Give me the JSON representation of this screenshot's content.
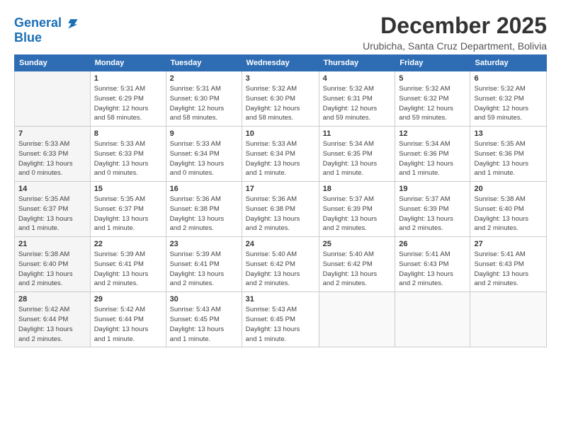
{
  "header": {
    "logo_line1": "General",
    "logo_line2": "Blue",
    "month_title": "December 2025",
    "subtitle": "Urubicha, Santa Cruz Department, Bolivia"
  },
  "calendar": {
    "days_of_week": [
      "Sunday",
      "Monday",
      "Tuesday",
      "Wednesday",
      "Thursday",
      "Friday",
      "Saturday"
    ],
    "weeks": [
      [
        {
          "day": "",
          "info": ""
        },
        {
          "day": "1",
          "info": "Sunrise: 5:31 AM\nSunset: 6:29 PM\nDaylight: 12 hours\nand 58 minutes."
        },
        {
          "day": "2",
          "info": "Sunrise: 5:31 AM\nSunset: 6:30 PM\nDaylight: 12 hours\nand 58 minutes."
        },
        {
          "day": "3",
          "info": "Sunrise: 5:32 AM\nSunset: 6:30 PM\nDaylight: 12 hours\nand 58 minutes."
        },
        {
          "day": "4",
          "info": "Sunrise: 5:32 AM\nSunset: 6:31 PM\nDaylight: 12 hours\nand 59 minutes."
        },
        {
          "day": "5",
          "info": "Sunrise: 5:32 AM\nSunset: 6:32 PM\nDaylight: 12 hours\nand 59 minutes."
        },
        {
          "day": "6",
          "info": "Sunrise: 5:32 AM\nSunset: 6:32 PM\nDaylight: 12 hours\nand 59 minutes."
        }
      ],
      [
        {
          "day": "7",
          "info": "Sunrise: 5:33 AM\nSunset: 6:33 PM\nDaylight: 13 hours\nand 0 minutes."
        },
        {
          "day": "8",
          "info": "Sunrise: 5:33 AM\nSunset: 6:33 PM\nDaylight: 13 hours\nand 0 minutes."
        },
        {
          "day": "9",
          "info": "Sunrise: 5:33 AM\nSunset: 6:34 PM\nDaylight: 13 hours\nand 0 minutes."
        },
        {
          "day": "10",
          "info": "Sunrise: 5:33 AM\nSunset: 6:34 PM\nDaylight: 13 hours\nand 1 minute."
        },
        {
          "day": "11",
          "info": "Sunrise: 5:34 AM\nSunset: 6:35 PM\nDaylight: 13 hours\nand 1 minute."
        },
        {
          "day": "12",
          "info": "Sunrise: 5:34 AM\nSunset: 6:36 PM\nDaylight: 13 hours\nand 1 minute."
        },
        {
          "day": "13",
          "info": "Sunrise: 5:35 AM\nSunset: 6:36 PM\nDaylight: 13 hours\nand 1 minute."
        }
      ],
      [
        {
          "day": "14",
          "info": "Sunrise: 5:35 AM\nSunset: 6:37 PM\nDaylight: 13 hours\nand 1 minute."
        },
        {
          "day": "15",
          "info": "Sunrise: 5:35 AM\nSunset: 6:37 PM\nDaylight: 13 hours\nand 1 minute."
        },
        {
          "day": "16",
          "info": "Sunrise: 5:36 AM\nSunset: 6:38 PM\nDaylight: 13 hours\nand 2 minutes."
        },
        {
          "day": "17",
          "info": "Sunrise: 5:36 AM\nSunset: 6:38 PM\nDaylight: 13 hours\nand 2 minutes."
        },
        {
          "day": "18",
          "info": "Sunrise: 5:37 AM\nSunset: 6:39 PM\nDaylight: 13 hours\nand 2 minutes."
        },
        {
          "day": "19",
          "info": "Sunrise: 5:37 AM\nSunset: 6:39 PM\nDaylight: 13 hours\nand 2 minutes."
        },
        {
          "day": "20",
          "info": "Sunrise: 5:38 AM\nSunset: 6:40 PM\nDaylight: 13 hours\nand 2 minutes."
        }
      ],
      [
        {
          "day": "21",
          "info": "Sunrise: 5:38 AM\nSunset: 6:40 PM\nDaylight: 13 hours\nand 2 minutes."
        },
        {
          "day": "22",
          "info": "Sunrise: 5:39 AM\nSunset: 6:41 PM\nDaylight: 13 hours\nand 2 minutes."
        },
        {
          "day": "23",
          "info": "Sunrise: 5:39 AM\nSunset: 6:41 PM\nDaylight: 13 hours\nand 2 minutes."
        },
        {
          "day": "24",
          "info": "Sunrise: 5:40 AM\nSunset: 6:42 PM\nDaylight: 13 hours\nand 2 minutes."
        },
        {
          "day": "25",
          "info": "Sunrise: 5:40 AM\nSunset: 6:42 PM\nDaylight: 13 hours\nand 2 minutes."
        },
        {
          "day": "26",
          "info": "Sunrise: 5:41 AM\nSunset: 6:43 PM\nDaylight: 13 hours\nand 2 minutes."
        },
        {
          "day": "27",
          "info": "Sunrise: 5:41 AM\nSunset: 6:43 PM\nDaylight: 13 hours\nand 2 minutes."
        }
      ],
      [
        {
          "day": "28",
          "info": "Sunrise: 5:42 AM\nSunset: 6:44 PM\nDaylight: 13 hours\nand 2 minutes."
        },
        {
          "day": "29",
          "info": "Sunrise: 5:42 AM\nSunset: 6:44 PM\nDaylight: 13 hours\nand 1 minute."
        },
        {
          "day": "30",
          "info": "Sunrise: 5:43 AM\nSunset: 6:45 PM\nDaylight: 13 hours\nand 1 minute."
        },
        {
          "day": "31",
          "info": "Sunrise: 5:43 AM\nSunset: 6:45 PM\nDaylight: 13 hours\nand 1 minute."
        },
        {
          "day": "",
          "info": ""
        },
        {
          "day": "",
          "info": ""
        },
        {
          "day": "",
          "info": ""
        }
      ]
    ]
  }
}
